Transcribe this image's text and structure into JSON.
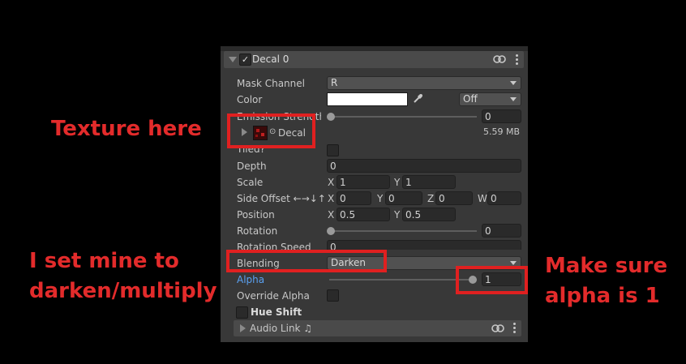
{
  "inspector": {
    "component_title": "Decal 0",
    "component_enabled": true,
    "mask_channel": {
      "label": "Mask Channel",
      "value": "R"
    },
    "color": {
      "label": "Color",
      "swatch": "#ffffff",
      "mode": "Off"
    },
    "emission_strength": {
      "label": "Emission Strength",
      "value": "0",
      "slider_fraction": 0
    },
    "texture": {
      "name": "Decal",
      "size": "5.59 MB"
    },
    "tiled": {
      "label": "Tiled?",
      "checked": false
    },
    "depth": {
      "label": "Depth",
      "value": "0"
    },
    "scale": {
      "label": "Scale",
      "x_axis": "X",
      "x": "1",
      "y_axis": "Y",
      "y": "1"
    },
    "side_offset": {
      "label": "Side Offset ←→↓↑",
      "x_axis": "X",
      "x": "0",
      "y_axis": "Y",
      "y": "0",
      "z_axis": "Z",
      "z": "0",
      "w_axis": "W",
      "w": "0"
    },
    "position": {
      "label": "Position",
      "x_axis": "X",
      "x": "0.5",
      "y_axis": "Y",
      "y": "0.5"
    },
    "rotation": {
      "label": "Rotation",
      "value": "0",
      "slider_fraction": 0
    },
    "rotation_speed": {
      "label": "Rotation Speed",
      "value": "0"
    },
    "blending": {
      "label": "Blending",
      "value": "Darken"
    },
    "alpha": {
      "label": "Alpha",
      "value": "1",
      "slider_fraction": 1
    },
    "override_alpha": {
      "label": "Override Alpha",
      "checked": false
    },
    "hue_shift": {
      "label": "Hue Shift",
      "checked": false
    },
    "audio_link": {
      "label": "Audio Link ♫"
    }
  },
  "annotations": {
    "texture_note": "Texture here",
    "blend_note_line1": "I set mine to",
    "blend_note_line2": "darken/multiply",
    "alpha_note_line1": "Make sure",
    "alpha_note_line2": "alpha is 1"
  },
  "colors": {
    "annotation_red": "#e32b2b",
    "panel_bg": "#383838",
    "field_bg": "#2a2a2a",
    "alpha_label": "#5aa0f0"
  }
}
